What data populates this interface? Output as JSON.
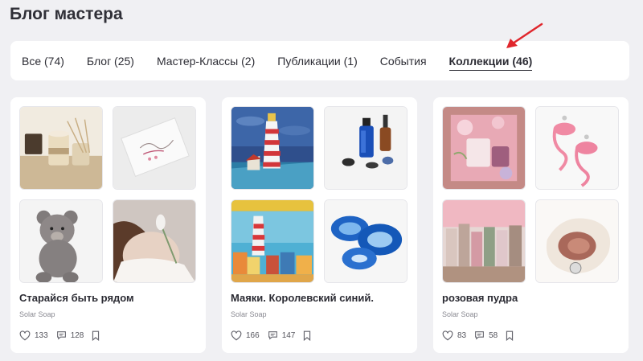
{
  "page": {
    "title": "Блог мастера"
  },
  "tabs": [
    {
      "label": "Все (74)",
      "active": false
    },
    {
      "label": "Блог (25)",
      "active": false
    },
    {
      "label": "Мастер-Классы (2)",
      "active": false
    },
    {
      "label": "Публикации (1)",
      "active": false
    },
    {
      "label": "События",
      "active": false
    },
    {
      "label": "Коллекции (46)",
      "active": true
    }
  ],
  "annotation": {
    "arrow_color": "#e0262c",
    "points_to": "Коллекции (46)"
  },
  "collections": [
    {
      "title": "Старайся быть рядом",
      "author": "Solar Soap",
      "likes": "133",
      "comments": "128",
      "thumbnails": [
        "soap-on-wood-photo",
        "greeting-card-photo",
        "teddy-bear-photo",
        "woman-with-flowers-photo"
      ]
    },
    {
      "title": "Маяки. Королевский синий.",
      "author": "Solar Soap",
      "likes": "166",
      "comments": "147",
      "thumbnails": [
        "lighthouse-painting",
        "blue-bottles-photo",
        "lighthouse-houses-painting",
        "blue-agate-slices-photo"
      ]
    },
    {
      "title": "розовая пудра",
      "author": "Solar Soap",
      "likes": "83",
      "comments": "58",
      "thumbnails": [
        "pink-gift-box-photo",
        "flamingo-earrings-photo",
        "pink-houses-photo",
        "seashell-photo"
      ]
    }
  ],
  "icons": {
    "like": "heart-icon",
    "comment": "comment-icon",
    "bookmark": "bookmark-icon"
  },
  "colors": {
    "background": "#f0f0f3",
    "card": "#ffffff",
    "text": "#2b2b33",
    "muted": "#8a8a92",
    "arrow": "#e0262c"
  }
}
